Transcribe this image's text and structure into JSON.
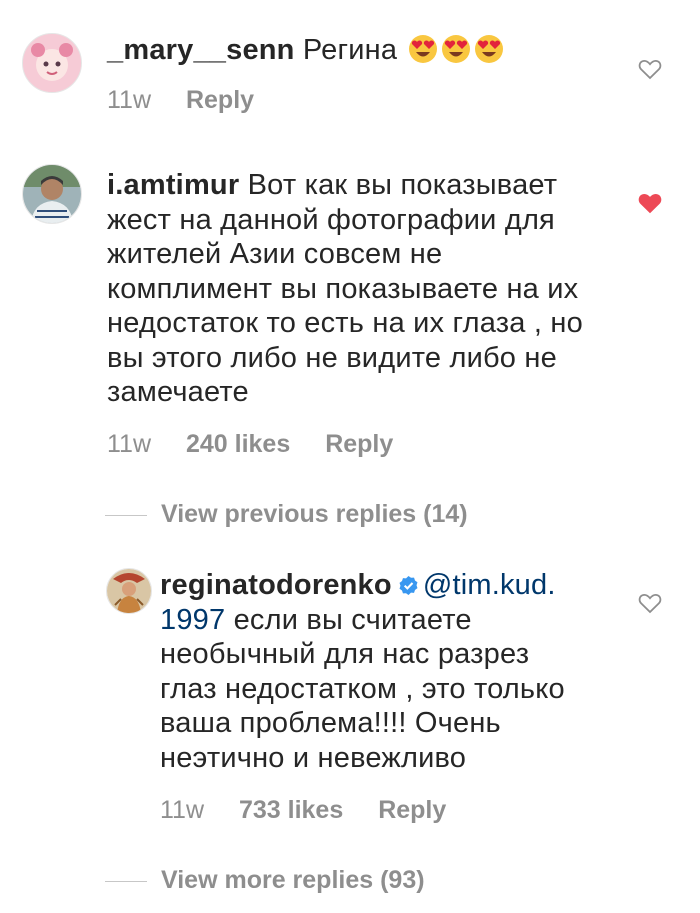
{
  "comments": [
    {
      "username": "_mary__senn",
      "text": "Регина",
      "emoji_count": 3,
      "time": "11w",
      "reply": "Reply",
      "liked": false
    },
    {
      "username": "i.amtimur",
      "lines": [
        "Вот как вы показывает",
        "жест на данной фотографии для",
        "жителей Азии совсем не",
        "комплимент вы показываете на их",
        "недостаток то есть на их глаза , но",
        "вы этого либо не видите либо не",
        "замечаете"
      ],
      "time": "11w",
      "likes": "240 likes",
      "reply": "Reply",
      "liked": true
    }
  ],
  "view_previous": "View previous replies (14)",
  "reply_comment": {
    "username": "reginatodorenko",
    "verified": true,
    "mention_part1": "@tim.kud.",
    "mention_part2": "1997",
    "lines": [
      "если вы считаете",
      "необычный для нас разрез",
      "глаз недостатком , это только",
      "ваша проблема!!!! Очень",
      "неэтично и невежливо"
    ],
    "time": "11w",
    "likes": "733 likes",
    "reply": "Reply",
    "liked": false
  },
  "view_more": "View more replies (93)",
  "colors": {
    "text": "#262626",
    "muted": "#8e8e8e",
    "mention": "#00376b",
    "heart_liked": "#ed4956",
    "verified": "#3897f0"
  }
}
